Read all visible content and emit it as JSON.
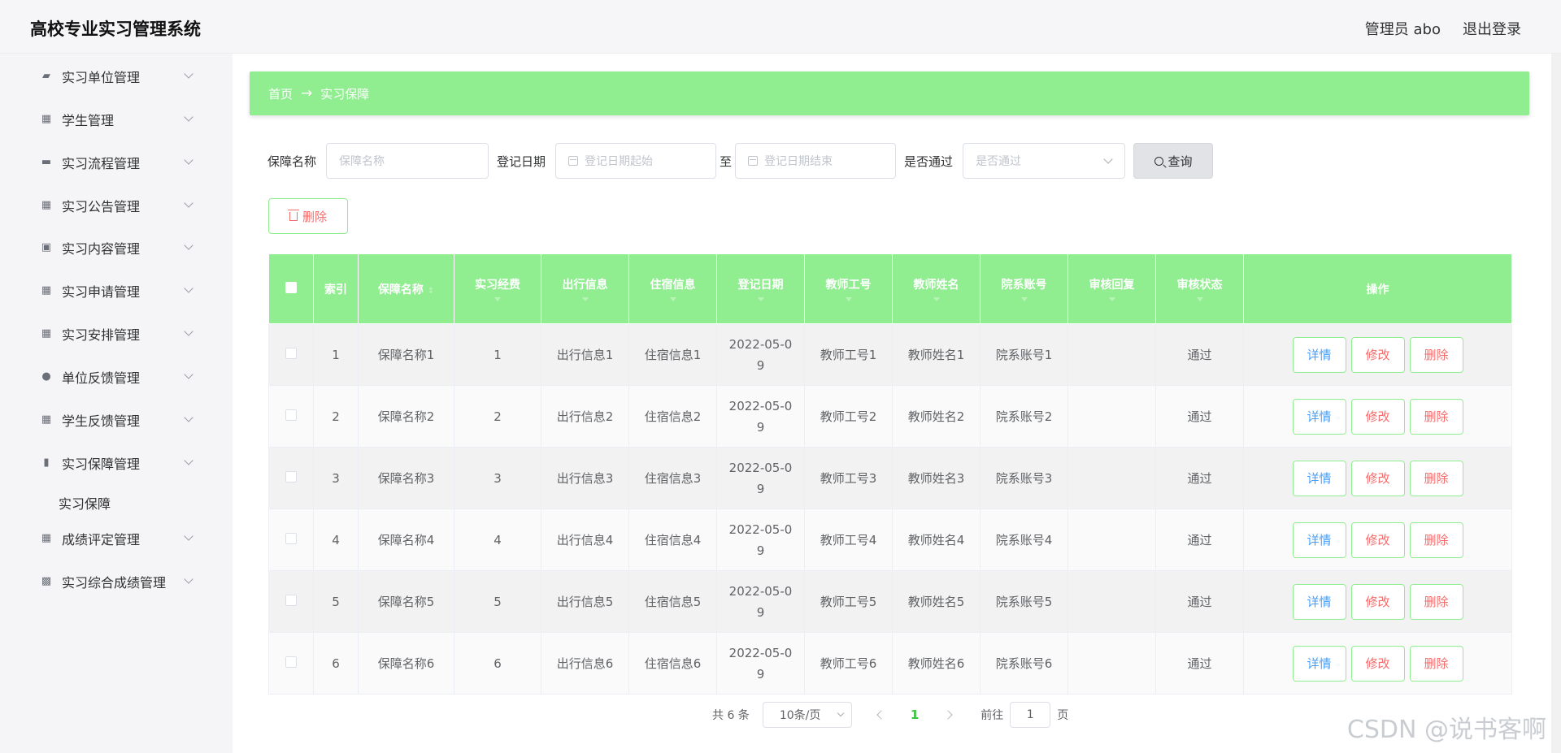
{
  "header": {
    "title": "高校专业实习管理系统",
    "admin": "管理员 abo",
    "logout": "退出登录"
  },
  "sidebar": {
    "items": [
      {
        "label": "实习单位管理",
        "icon": "ticket-icon"
      },
      {
        "label": "学生管理",
        "icon": "grid-icon"
      },
      {
        "label": "实习流程管理",
        "icon": "chat-icon"
      },
      {
        "label": "实习公告管理",
        "icon": "grid-icon"
      },
      {
        "label": "实习内容管理",
        "icon": "clipboard-icon"
      },
      {
        "label": "实习申请管理",
        "icon": "grid-icon"
      },
      {
        "label": "实习安排管理",
        "icon": "grid-icon"
      },
      {
        "label": "单位反馈管理",
        "icon": "bulb-icon"
      },
      {
        "label": "学生反馈管理",
        "icon": "grid-icon"
      },
      {
        "label": "实习保障管理",
        "icon": "bar-chart-icon"
      },
      {
        "label": "成绩评定管理",
        "icon": "grid-icon"
      },
      {
        "label": "实习综合成绩管理",
        "icon": "grid-dense-icon"
      }
    ],
    "submenu": {
      "label": "实习保障"
    }
  },
  "breadcrumb": {
    "home": "首页",
    "arrow": "→",
    "current": "实习保障"
  },
  "search": {
    "name_label": "保障名称",
    "name_placeholder": "保障名称",
    "date_label": "登记日期",
    "date_start_placeholder": "登记日期起始",
    "date_to": "至",
    "date_end_placeholder": "登记日期结束",
    "pass_label": "是否通过",
    "pass_placeholder": "是否通过",
    "query_button": "查询"
  },
  "toolbar": {
    "delete_button": "删除"
  },
  "table": {
    "headers": {
      "index": "索引",
      "name": "保障名称",
      "fee": "实习经费",
      "travel": "出行信息",
      "lodging": "住宿信息",
      "date": "登记日期",
      "teacher_id": "教师工号",
      "teacher_name": "教师姓名",
      "dept_account": "院系账号",
      "review_reply": "审核回复",
      "review_status": "审核状态",
      "actions": "操作"
    },
    "rows": [
      {
        "index": "1",
        "name": "保障名称1",
        "fee": "1",
        "travel": "出行信息1",
        "lodging": "住宿信息1",
        "date": "2022-05-09",
        "teacher_id": "教师工号1",
        "teacher_name": "教师姓名1",
        "dept_account": "院系账号1",
        "review_reply": "",
        "review_status": "通过"
      },
      {
        "index": "2",
        "name": "保障名称2",
        "fee": "2",
        "travel": "出行信息2",
        "lodging": "住宿信息2",
        "date": "2022-05-09",
        "teacher_id": "教师工号2",
        "teacher_name": "教师姓名2",
        "dept_account": "院系账号2",
        "review_reply": "",
        "review_status": "通过"
      },
      {
        "index": "3",
        "name": "保障名称3",
        "fee": "3",
        "travel": "出行信息3",
        "lodging": "住宿信息3",
        "date": "2022-05-09",
        "teacher_id": "教师工号3",
        "teacher_name": "教师姓名3",
        "dept_account": "院系账号3",
        "review_reply": "",
        "review_status": "通过"
      },
      {
        "index": "4",
        "name": "保障名称4",
        "fee": "4",
        "travel": "出行信息4",
        "lodging": "住宿信息4",
        "date": "2022-05-09",
        "teacher_id": "教师工号4",
        "teacher_name": "教师姓名4",
        "dept_account": "院系账号4",
        "review_reply": "",
        "review_status": "通过"
      },
      {
        "index": "5",
        "name": "保障名称5",
        "fee": "5",
        "travel": "出行信息5",
        "lodging": "住宿信息5",
        "date": "2022-05-09",
        "teacher_id": "教师工号5",
        "teacher_name": "教师姓名5",
        "dept_account": "院系账号5",
        "review_reply": "",
        "review_status": "通过"
      },
      {
        "index": "6",
        "name": "保障名称6",
        "fee": "6",
        "travel": "出行信息6",
        "lodging": "住宿信息6",
        "date": "2022-05-09",
        "teacher_id": "教师工号6",
        "teacher_name": "教师姓名6",
        "dept_account": "院系账号6",
        "review_reply": "",
        "review_status": "通过"
      }
    ],
    "action_labels": {
      "detail": "详情",
      "edit": "修改",
      "delete": "删除"
    }
  },
  "pagination": {
    "total": "共 6 条",
    "page_size": "10条/页",
    "current_page": "1",
    "goto_prefix": "前往",
    "goto_value": "1",
    "goto_suffix": "页"
  },
  "watermark": "CSDN @说书客啊",
  "colors": {
    "accent": "#90ee90",
    "danger": "#f56c6c",
    "info": "#409eff"
  }
}
